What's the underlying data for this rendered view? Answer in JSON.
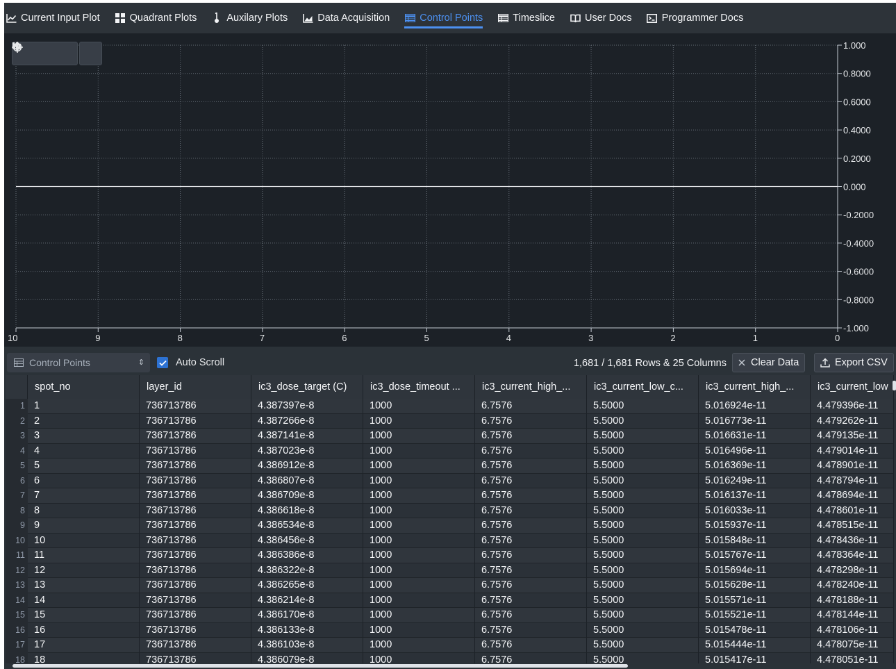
{
  "nav": {
    "items": [
      {
        "label": "Current Input Plot",
        "icon": "line-chart-icon",
        "active": false
      },
      {
        "label": "Quadrant Plots",
        "icon": "grid-icon",
        "active": false
      },
      {
        "label": "Auxilary Plots",
        "icon": "thermometer-icon",
        "active": false
      },
      {
        "label": "Data Acquisition",
        "icon": "area-chart-icon",
        "active": false
      },
      {
        "label": "Control Points",
        "icon": "table-icon",
        "active": true
      },
      {
        "label": "Timeslice",
        "icon": "table-icon",
        "active": false
      },
      {
        "label": "User Docs",
        "icon": "book-icon",
        "active": false
      },
      {
        "label": "Programmer Docs",
        "icon": "console-icon",
        "active": false
      }
    ]
  },
  "plot": {
    "toolbar": [
      "gear-icon",
      "close-icon",
      "pause-icon",
      "locate-icon"
    ],
    "chart_data": {
      "type": "line",
      "series": [
        {
          "x": [
            10,
            0
          ],
          "values": [
            0,
            0
          ]
        }
      ],
      "x_ticks": [
        "10",
        "9",
        "8",
        "7",
        "6",
        "5",
        "4",
        "3",
        "2",
        "1",
        "0"
      ],
      "y_ticks": [
        "1.000",
        "0.8000",
        "0.6000",
        "0.4000",
        "0.2000",
        "0.000",
        "-0.2000",
        "-0.4000",
        "-0.6000",
        "-0.8000",
        "-1.000"
      ],
      "xlim": [
        10,
        0
      ],
      "ylim": [
        -1,
        1
      ],
      "grid": true,
      "background": "#1c2127",
      "line_color": "#e8eaed"
    }
  },
  "table_toolbar": {
    "source_select": "Control Points",
    "auto_scroll_label": "Auto Scroll",
    "auto_scroll_checked": true,
    "row_count": "1,681 / 1,681 Rows & 25 Columns",
    "clear_label": "Clear Data",
    "export_label": "Export CSV"
  },
  "table": {
    "columns": [
      "spot_no",
      "layer_id",
      "ic3_dose_target (C)",
      "ic3_dose_timeout ...",
      "ic3_current_high_...",
      "ic3_current_low_c...",
      "ic3_current_high_...",
      "ic3_current_low"
    ],
    "rows": [
      [
        "1",
        "1",
        "736713786",
        "4.387397e-8",
        "1000",
        "6.7576",
        "5.5000",
        "5.016924e-11",
        "4.479396e-11"
      ],
      [
        "2",
        "2",
        "736713786",
        "4.387266e-8",
        "1000",
        "6.7576",
        "5.5000",
        "5.016773e-11",
        "4.479262e-11"
      ],
      [
        "3",
        "3",
        "736713786",
        "4.387141e-8",
        "1000",
        "6.7576",
        "5.5000",
        "5.016631e-11",
        "4.479135e-11"
      ],
      [
        "4",
        "4",
        "736713786",
        "4.387023e-8",
        "1000",
        "6.7576",
        "5.5000",
        "5.016496e-11",
        "4.479014e-11"
      ],
      [
        "5",
        "5",
        "736713786",
        "4.386912e-8",
        "1000",
        "6.7576",
        "5.5000",
        "5.016369e-11",
        "4.478901e-11"
      ],
      [
        "6",
        "6",
        "736713786",
        "4.386807e-8",
        "1000",
        "6.7576",
        "5.5000",
        "5.016249e-11",
        "4.478794e-11"
      ],
      [
        "7",
        "7",
        "736713786",
        "4.386709e-8",
        "1000",
        "6.7576",
        "5.5000",
        "5.016137e-11",
        "4.478694e-11"
      ],
      [
        "8",
        "8",
        "736713786",
        "4.386618e-8",
        "1000",
        "6.7576",
        "5.5000",
        "5.016033e-11",
        "4.478601e-11"
      ],
      [
        "9",
        "9",
        "736713786",
        "4.386534e-8",
        "1000",
        "6.7576",
        "5.5000",
        "5.015937e-11",
        "4.478515e-11"
      ],
      [
        "10",
        "10",
        "736713786",
        "4.386456e-8",
        "1000",
        "6.7576",
        "5.5000",
        "5.015848e-11",
        "4.478436e-11"
      ],
      [
        "11",
        "11",
        "736713786",
        "4.386386e-8",
        "1000",
        "6.7576",
        "5.5000",
        "5.015767e-11",
        "4.478364e-11"
      ],
      [
        "12",
        "12",
        "736713786",
        "4.386322e-8",
        "1000",
        "6.7576",
        "5.5000",
        "5.015694e-11",
        "4.478298e-11"
      ],
      [
        "13",
        "13",
        "736713786",
        "4.386265e-8",
        "1000",
        "6.7576",
        "5.5000",
        "5.015628e-11",
        "4.478240e-11"
      ],
      [
        "14",
        "14",
        "736713786",
        "4.386214e-8",
        "1000",
        "6.7576",
        "5.5000",
        "5.015571e-11",
        "4.478188e-11"
      ],
      [
        "15",
        "15",
        "736713786",
        "4.386170e-8",
        "1000",
        "6.7576",
        "5.5000",
        "5.015521e-11",
        "4.478144e-11"
      ],
      [
        "16",
        "16",
        "736713786",
        "4.386133e-8",
        "1000",
        "6.7576",
        "5.5000",
        "5.015478e-11",
        "4.478106e-11"
      ],
      [
        "17",
        "17",
        "736713786",
        "4.386103e-8",
        "1000",
        "6.7576",
        "5.5000",
        "5.015444e-11",
        "4.478075e-11"
      ],
      [
        "18",
        "18",
        "736713786",
        "4.386079e-8",
        "1000",
        "6.7576",
        "5.5000",
        "5.015417e-11",
        "4.478051e-11"
      ]
    ]
  }
}
